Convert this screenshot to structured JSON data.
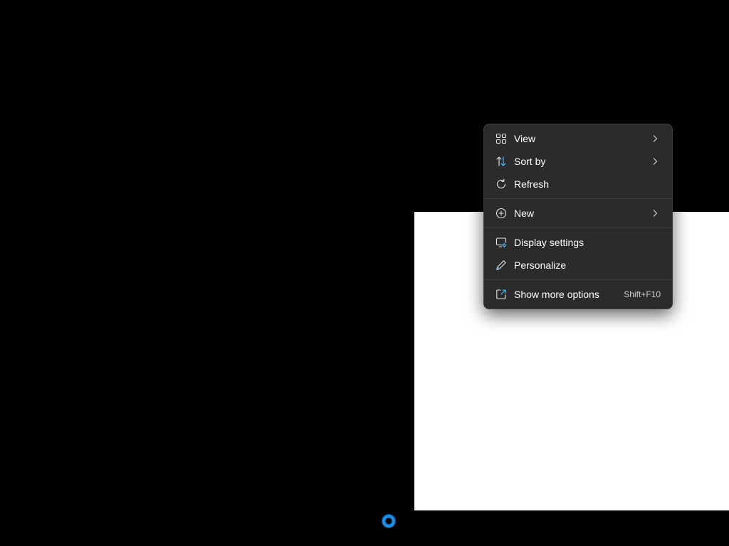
{
  "menu": {
    "items": [
      {
        "id": "view",
        "label": "View",
        "icon": "grid-icon",
        "has_submenu": true
      },
      {
        "id": "sort",
        "label": "Sort by",
        "icon": "sort-arrows-icon",
        "has_submenu": true
      },
      {
        "id": "refresh",
        "label": "Refresh",
        "icon": "refresh-icon",
        "has_submenu": false
      },
      {
        "id": "new",
        "label": "New",
        "icon": "plus-circle-icon",
        "has_submenu": true
      },
      {
        "id": "display",
        "label": "Display settings",
        "icon": "display-settings-icon",
        "has_submenu": false
      },
      {
        "id": "personalize",
        "label": "Personalize",
        "icon": "pen-icon",
        "has_submenu": false
      },
      {
        "id": "more",
        "label": "Show more options",
        "icon": "open-external-icon",
        "shortcut": "Shift+F10"
      }
    ]
  },
  "colors": {
    "menu_background": "#2b2b2b",
    "menu_text": "#ffffff",
    "accent": "#4cc2ff",
    "cursor": "#1f8fe6",
    "desktop": "#000000",
    "window": "#ffffff"
  }
}
